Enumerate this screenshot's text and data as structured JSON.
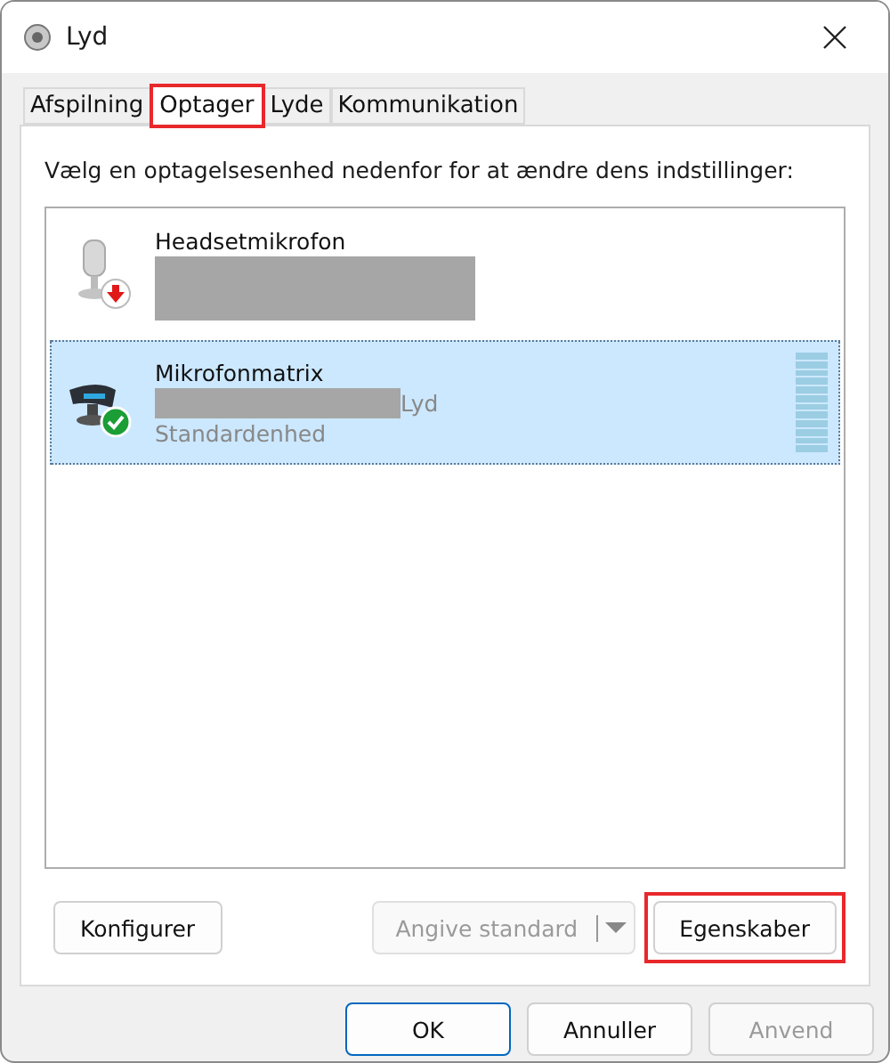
{
  "window": {
    "title": "Lyd"
  },
  "tabs": [
    {
      "label": "Afspilning",
      "selected": false,
      "highlighted": false
    },
    {
      "label": "Optager",
      "selected": true,
      "highlighted": true
    },
    {
      "label": "Lyde",
      "selected": false,
      "highlighted": false
    },
    {
      "label": "Kommunikation",
      "selected": false,
      "highlighted": false
    }
  ],
  "instruction": "Vælg en optagelsesenhed nedenfor for at ændre dens indstillinger:",
  "devices": [
    {
      "name": "Headsetmikrofon",
      "kind": "headset",
      "unplugged": true,
      "default_device": false,
      "selected": false,
      "redacted": true
    },
    {
      "name": "Mikrofonmatrix",
      "kind": "array",
      "unplugged": false,
      "default_device": true,
      "selected": true,
      "redacted": true,
      "detail_suffix": "Lyd",
      "state_text": "Standardenhed"
    }
  ],
  "panel_buttons": [
    {
      "label": "Konfigurer",
      "kind": "plain",
      "disabled": false,
      "highlighted": false
    },
    {
      "label": "Angive standard",
      "kind": "split",
      "disabled": true,
      "highlighted": false
    },
    {
      "label": "Egenskaber",
      "kind": "plain",
      "disabled": false,
      "highlighted": true
    }
  ],
  "dialog_buttons": [
    {
      "label": "OK",
      "default": true,
      "disabled": false
    },
    {
      "label": "Annuller",
      "default": false,
      "disabled": false
    },
    {
      "label": "Anvend",
      "default": false,
      "disabled": true
    }
  ]
}
